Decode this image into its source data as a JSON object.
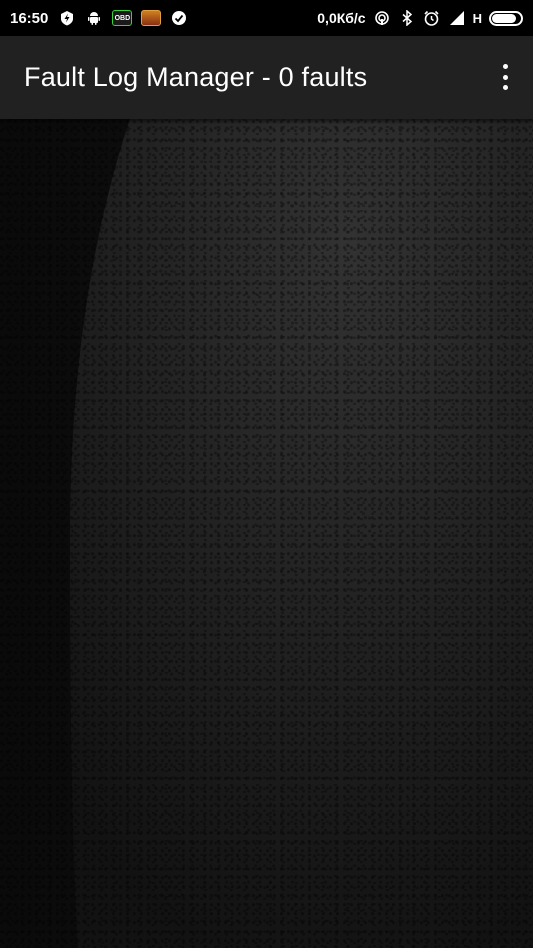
{
  "status_bar": {
    "time": "16:50",
    "left_icons": [
      "charging-bolt-icon",
      "android-icon",
      "obd-app-icon",
      "car-app-icon",
      "check-circle-icon"
    ],
    "obd_label": "OBD",
    "net_speed": "0,0Кб/с",
    "right_icons": [
      "hotspot-icon",
      "bluetooth-icon",
      "alarm-clock-icon",
      "signal-bars-icon"
    ],
    "network_type": "H",
    "battery_level": 0.85
  },
  "app_bar": {
    "title": "Fault Log Manager - 0 faults",
    "overflow_icon": "more-vertical-icon"
  },
  "colors": {
    "status_bar_bg": "#000000",
    "app_bar_bg": "#212121",
    "content_bg": "#1c1c1c",
    "text": "#ffffff",
    "obd_accent": "#3ad13a"
  }
}
